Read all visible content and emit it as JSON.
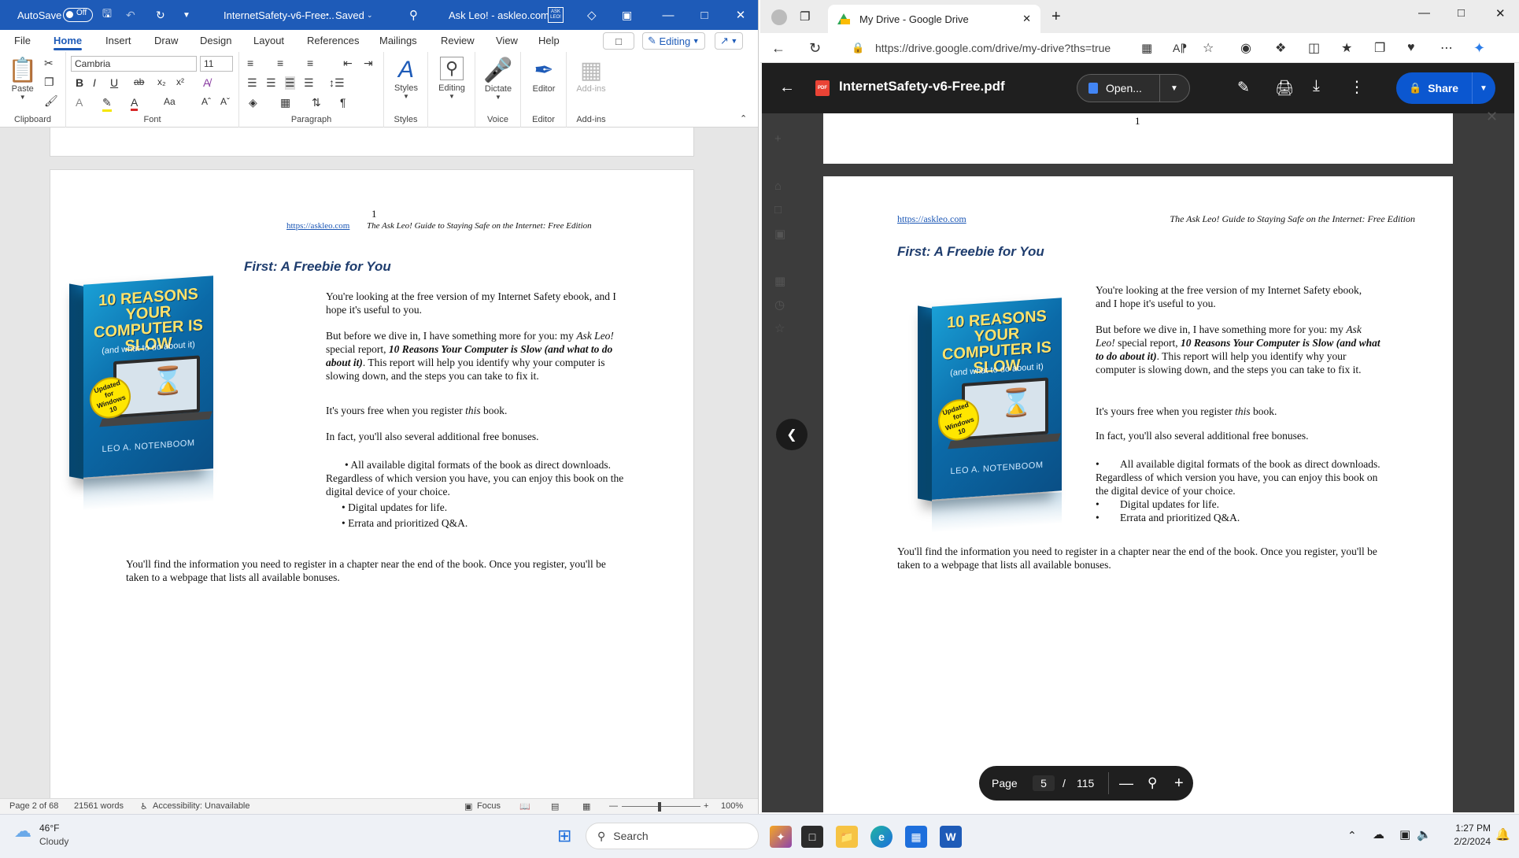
{
  "word": {
    "autosave_label": "AutoSave",
    "autosave_state": "Off",
    "doc_title": "InternetSafety-v6-Free...",
    "saved_state": "Saved",
    "search_text": "Ask Leo! - askleo.com",
    "ask_badge": "ASK LEO!",
    "tabs": [
      "File",
      "Home",
      "Insert",
      "Draw",
      "Design",
      "Layout",
      "References",
      "Mailings",
      "Review",
      "View",
      "Help"
    ],
    "editing_label": "Editing",
    "ribbon": {
      "paste": "Paste",
      "font_name": "Cambria",
      "font_size": "11",
      "styles": "Styles",
      "editing": "Editing",
      "dictate": "Dictate",
      "editor": "Editor",
      "addins": "Add-ins",
      "groups": {
        "clipboard": "Clipboard",
        "font": "Font",
        "paragraph": "Paragraph",
        "styles": "Styles",
        "voice": "Voice",
        "editor": "Editor",
        "addins": "Add-ins"
      }
    },
    "document": {
      "page_number": "1",
      "header_link": "https://askleo.com",
      "header_title": "The Ask Leo! Guide to Staying Safe on the Internet: Free Edition",
      "heading": "First: A Freebie for You",
      "p1": "You're looking at the free version of my Internet Safety ebook, and I hope it's useful to you.",
      "p2_a": "But before we dive in, I have something more for you: my ",
      "p2_em": "Ask Leo!",
      "p2_b": " special report, ",
      "p2_strong": "10 Reasons Your Computer is Slow (and what to do about it)",
      "p2_c": ". This report will help you identify why your computer is slowing down, and the steps you can take to fix it.",
      "p3_a": "It's yours free when you register ",
      "p3_em": "this",
      "p3_b": " book.",
      "p4": "In fact, you'll also several additional free bonuses.",
      "bullets": [
        "All available digital formats of the book as direct downloads. Regardless of which version you have, you can enjoy this book on the digital device of your choice.",
        "Digital updates for life.",
        "Errata and prioritized Q&A."
      ],
      "p5": "You'll find the information you need to register in a chapter near the end of the book. Once you register, you'll be taken to a webpage that lists all available bonuses."
    },
    "book": {
      "title": "10 REASONS YOUR COMPUTER IS SLOW",
      "subtitle": "(and what to do about it)",
      "badge_1": "Updated",
      "badge_2": "for",
      "badge_3": "Windows 10",
      "author": "LEO A. NOTENBOOM"
    },
    "status": {
      "page": "Page 2 of 68",
      "words": "21561 words",
      "accessibility": "Accessibility: Unavailable",
      "focus": "Focus",
      "zoom": "100%"
    }
  },
  "edge": {
    "tab_title": "My Drive - Google Drive",
    "url": "https://drive.google.com/drive/my-drive?ths=true",
    "pdf_title": "InternetSafety-v6-Free.pdf",
    "open_label": "Open...",
    "share_label": "Share",
    "page_label": "Page",
    "current_page": "5",
    "page_sep": "/",
    "total_pages": "115"
  },
  "taskbar": {
    "temperature": "46°F",
    "weather": "Cloudy",
    "search_placeholder": "Search",
    "time": "1:27 PM",
    "date": "2/2/2024"
  },
  "colors": {
    "word_blue": "#1e5bb8",
    "drive_blue": "#0b57d0",
    "viewer_dark": "#1f1f1f",
    "heading_navy": "#1f3d6e"
  }
}
